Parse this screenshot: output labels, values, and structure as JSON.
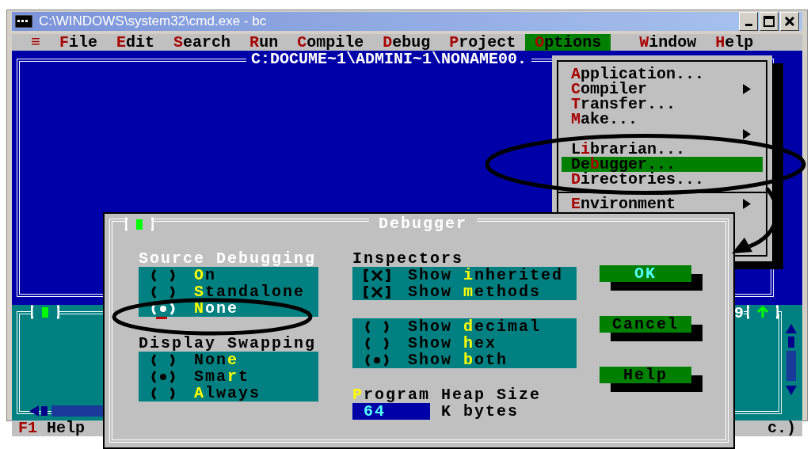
{
  "window": {
    "title": "C:\\WINDOWS\\system32\\cmd.exe - bc"
  },
  "menu_bar": [
    {
      "label": "≡",
      "kind": "system",
      "selected": false
    },
    {
      "label": "**F**ile",
      "kind": "menu",
      "selected": false
    },
    {
      "label": "**E**dit",
      "kind": "menu",
      "selected": false
    },
    {
      "label": "**S**earch",
      "kind": "menu",
      "selected": false
    },
    {
      "label": "**R**un",
      "kind": "menu",
      "selected": false
    },
    {
      "label": "**C**ompile",
      "kind": "menu",
      "selected": false
    },
    {
      "label": "**D**ebug",
      "kind": "menu",
      "selected": false
    },
    {
      "label": "**P**roject",
      "kind": "menu",
      "selected": false
    },
    {
      "label": "**O**ptions",
      "kind": "menu",
      "selected": true
    },
    {
      "label": "**W**indow",
      "kind": "menu",
      "selected": false
    },
    {
      "label": "**H**elp",
      "kind": "menu",
      "selected": false
    }
  ],
  "editor_window": {
    "title": "C:DOCUME~1\\ADMINI~1\\NONAME00."
  },
  "options_menu": {
    "items": [
      {
        "label": "**A**pplication...",
        "submenu": false,
        "selected": false
      },
      {
        "label": "**C**ompiler",
        "submenu": true,
        "selected": false
      },
      {
        "label": "**T**ransfer...",
        "submenu": false,
        "selected": false
      },
      {
        "label": "**M**ake...",
        "submenu": false,
        "selected": false
      },
      {
        "submenu": true,
        "selected": false
      },
      {
        "label": "L**i**brarian...",
        "submenu": false,
        "selected": false
      },
      {
        "label": "De**b**ugger...",
        "submenu": false,
        "selected": true
      },
      {
        "label": "**D**irectories...",
        "submenu": false,
        "selected": false
      },
      {
        "label": "**E**nvironment",
        "submenu": true,
        "selected": false,
        "separator_before": true
      }
    ]
  },
  "lower_window": {
    "number": "9"
  },
  "status_bar": {
    "left": "**F1** Help",
    "right": "c.)"
  },
  "dialog": {
    "title": "Debugger",
    "source_debugging": {
      "label": "Source Debugging",
      "focused": true,
      "options": [
        {
          "label": "**O**n",
          "selected": false,
          "focused": false
        },
        {
          "label": "**S**tandalone",
          "selected": false,
          "focused": false
        },
        {
          "label": "**N**one",
          "selected": true,
          "focused": true
        }
      ]
    },
    "display_swapping": {
      "label": "Display Swapping",
      "focused": false,
      "options": [
        {
          "label": "Non**e**",
          "selected": false,
          "focused": false
        },
        {
          "label": "Sma**r**t",
          "selected": true,
          "focused": false
        },
        {
          "label": "**A**lways",
          "selected": false,
          "focused": false
        }
      ]
    },
    "inspectors": {
      "label": "Inspectors",
      "options": [
        {
          "label": "Show **i**nherited",
          "checked": true
        },
        {
          "label": "Show **m**ethods",
          "checked": true
        }
      ]
    },
    "display_format": {
      "options": [
        {
          "label": "Show **d**ecimal",
          "selected": false
        },
        {
          "label": "Show **h**ex",
          "selected": false
        },
        {
          "label": "Show **b**oth",
          "selected": true
        }
      ]
    },
    "heap_size": {
      "label": "**P**rogram Heap Size",
      "value": "64",
      "unit": "K bytes"
    },
    "buttons": [
      {
        "label": "OK",
        "default": true
      },
      {
        "label": "Cancel",
        "default": false
      },
      {
        "label": "Help",
        "default": false
      }
    ]
  }
}
